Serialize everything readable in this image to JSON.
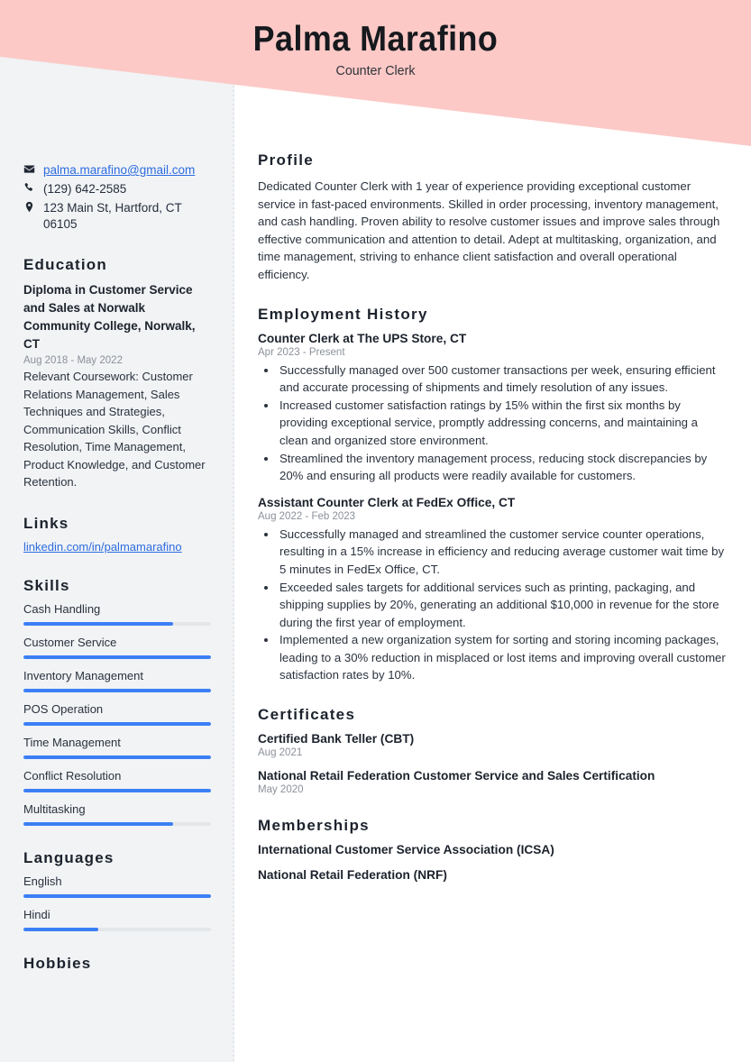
{
  "header": {
    "name": "Palma Marafino",
    "subtitle": "Counter Clerk",
    "band_color": "#fcc9c6"
  },
  "theme": {
    "sidebar_bg": "#f1f3f5",
    "accent_blue": "#3b7ff5",
    "link_blue": "#2d6ce0",
    "text_dark": "#1c222c",
    "muted": "#8b9099"
  },
  "sidebar": {
    "contact": {
      "email": "palma.marafino@gmail.com",
      "phone": "(129) 642-2585",
      "address": "123 Main St, Hartford, CT 06105"
    },
    "education": {
      "heading": "Education",
      "items": [
        {
          "title": "Diploma in Customer Service and Sales at Norwalk Community College, Norwalk, CT",
          "date": "Aug 2018 - May 2022",
          "description": "Relevant Coursework: Customer Relations Management, Sales Techniques and Strategies, Communication Skills, Conflict Resolution, Time Management, Product Knowledge, and Customer Retention."
        }
      ]
    },
    "links": {
      "heading": "Links",
      "items": [
        {
          "label": "linkedin.com/in/palmamarafino"
        }
      ]
    },
    "skills": {
      "heading": "Skills",
      "items": [
        {
          "label": "Cash Handling",
          "level": 80
        },
        {
          "label": "Customer Service",
          "level": 100
        },
        {
          "label": "Inventory Management",
          "level": 100
        },
        {
          "label": "POS Operation",
          "level": 100
        },
        {
          "label": "Time Management",
          "level": 100
        },
        {
          "label": "Conflict Resolution",
          "level": 100
        },
        {
          "label": "Multitasking",
          "level": 80
        }
      ]
    },
    "languages": {
      "heading": "Languages",
      "items": [
        {
          "label": "English",
          "level": 100
        },
        {
          "label": "Hindi",
          "level": 40
        }
      ]
    },
    "hobbies": {
      "heading": "Hobbies"
    }
  },
  "main": {
    "profile": {
      "heading": "Profile",
      "text": "Dedicated Counter Clerk with 1 year of experience providing exceptional customer service in fast-paced environments. Skilled in order processing, inventory management, and cash handling. Proven ability to resolve customer issues and improve sales through effective communication and attention to detail. Adept at multitasking, organization, and time management, striving to enhance client satisfaction and overall operational efficiency."
    },
    "employment": {
      "heading": "Employment History",
      "jobs": [
        {
          "title": "Counter Clerk at The UPS Store, CT",
          "date": "Apr 2023 - Present",
          "bullets": [
            "Successfully managed over 500 customer transactions per week, ensuring efficient and accurate processing of shipments and timely resolution of any issues.",
            "Increased customer satisfaction ratings by 15% within the first six months by providing exceptional service, promptly addressing concerns, and maintaining a clean and organized store environment.",
            "Streamlined the inventory management process, reducing stock discrepancies by 20% and ensuring all products were readily available for customers."
          ]
        },
        {
          "title": "Assistant Counter Clerk at FedEx Office, CT",
          "date": "Aug 2022 - Feb 2023",
          "bullets": [
            "Successfully managed and streamlined the customer service counter operations, resulting in a 15% increase in efficiency and reducing average customer wait time by 5 minutes in FedEx Office, CT.",
            "Exceeded sales targets for additional services such as printing, packaging, and shipping supplies by 20%, generating an additional $10,000 in revenue for the store during the first year of employment.",
            "Implemented a new organization system for sorting and storing incoming packages, leading to a 30% reduction in misplaced or lost items and improving overall customer satisfaction rates by 10%."
          ]
        }
      ]
    },
    "certificates": {
      "heading": "Certificates",
      "items": [
        {
          "title": "Certified Bank Teller (CBT)",
          "date": "Aug 2021"
        },
        {
          "title": "National Retail Federation Customer Service and Sales Certification",
          "date": "May 2020"
        }
      ]
    },
    "memberships": {
      "heading": "Memberships",
      "items": [
        {
          "title": "International Customer Service Association (ICSA)"
        },
        {
          "title": "National Retail Federation (NRF)"
        }
      ]
    }
  }
}
